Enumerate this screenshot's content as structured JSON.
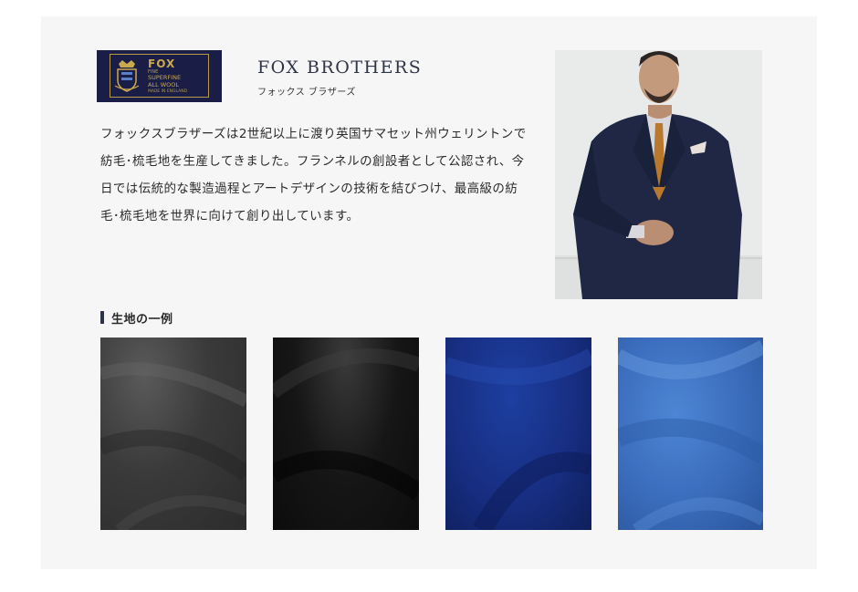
{
  "logo": {
    "brand": "FOX",
    "line_small": "FINE",
    "line1": "SUPERFINE",
    "line2": "ALL WOOL",
    "line3": "MADE IN ENGLAND"
  },
  "brand": {
    "name": "FOX BROTHERS",
    "name_jp": "フォックス ブラザーズ"
  },
  "description": "フォックスブラザーズは2世紀以上に渡り英国サマセット州ウェリントンで紡毛･梳毛地を生産してきました。フランネルの創設者として公認され、今日では伝統的な製造過程とアートデザインの技術を結びつけ、最高級の紡毛･梳毛地を世界に向けて創り出しています。",
  "section": {
    "title": "生地の一例"
  },
  "swatches": [
    {
      "name": "charcoal-flannel",
      "color": "#3a3a3a"
    },
    {
      "name": "black-flannel",
      "color": "#141414"
    },
    {
      "name": "navy-worsted",
      "color": "#172e82"
    },
    {
      "name": "blue-flannel",
      "color": "#3a6cbc"
    }
  ],
  "colors": {
    "card_bg": "#f6f6f6",
    "logo_bg": "#1a1d45",
    "logo_gold": "#c9a94e",
    "accent_bar": "#2e3448"
  }
}
